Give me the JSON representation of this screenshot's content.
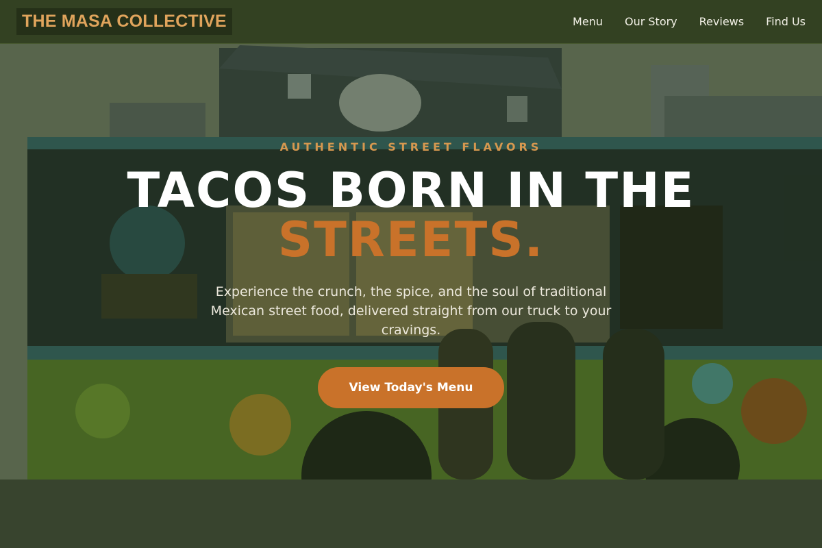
{
  "header": {
    "brand": "THE MASA COLLECTIVE",
    "nav": [
      {
        "label": "Menu"
      },
      {
        "label": "Our Story"
      },
      {
        "label": "Reviews"
      },
      {
        "label": "Find Us"
      }
    ]
  },
  "hero": {
    "kicker": "AUTHENTIC STREET FLAVORS",
    "headline_line1": "TACOS BORN IN THE",
    "headline_line2": "STREETS.",
    "subtext": "Experience the crunch, the spice, and the soul of traditional Mexican street food, delivered straight from our truck to your cravings.",
    "cta_label": "View Today's Menu"
  },
  "colors": {
    "brand_accent": "#e0a45c",
    "cta_orange": "#c9722a",
    "overlay_green": "#263618"
  }
}
